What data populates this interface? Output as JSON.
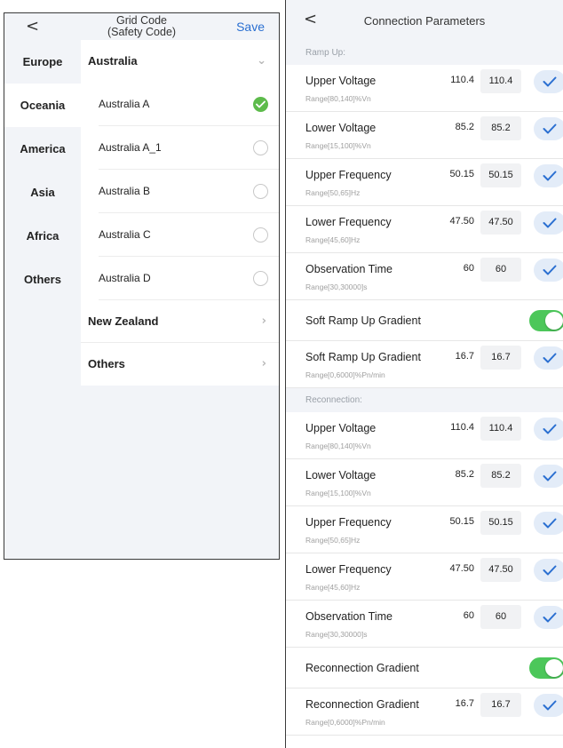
{
  "left": {
    "back_icon": "<",
    "title_line1": "Grid Code",
    "title_line2": "(Safety Code)",
    "save_label": "Save",
    "regions": [
      "Europe",
      "Oceania",
      "America",
      "Asia",
      "Africa",
      "Others"
    ],
    "active_region": "Oceania",
    "groups": [
      {
        "label": "Australia",
        "chevron": "chevron-down-icon"
      },
      {
        "label": "New Zealand",
        "chevron": "chevron-right-icon"
      },
      {
        "label": "Others",
        "chevron": "chevron-right-icon"
      }
    ],
    "countries": [
      {
        "label": "Australia A",
        "selected": true
      },
      {
        "label": "Australia A_1",
        "selected": false
      },
      {
        "label": "Australia B",
        "selected": false
      },
      {
        "label": "Australia C",
        "selected": false
      },
      {
        "label": "Australia D",
        "selected": false
      }
    ]
  },
  "right": {
    "back_icon": "<",
    "title": "Connection Parameters",
    "ramp_up": {
      "header": "Ramp Up:",
      "params": [
        {
          "name": "Upper Voltage",
          "range": "Range[80,140]%Vn",
          "current": "110.4",
          "input": "110.4"
        },
        {
          "name": "Lower Voltage",
          "range": "Range[15,100]%Vn",
          "current": "85.2",
          "input": "85.2"
        },
        {
          "name": "Upper Frequency",
          "range": "Range[50,65]Hz",
          "current": "50.15",
          "input": "50.15"
        },
        {
          "name": "Lower Frequency",
          "range": "Range[45,60]Hz",
          "current": "47.50",
          "input": "47.50"
        },
        {
          "name": "Observation Time",
          "range": "Range[30,30000]s",
          "current": "60",
          "input": "60"
        }
      ],
      "toggle_label": "Soft Ramp Up Gradient",
      "toggle_on": true,
      "gradient": {
        "name": "Soft Ramp Up Gradient",
        "range": "Range[0,6000]%Pn/min",
        "current": "16.7",
        "input": "16.7"
      }
    },
    "reconnection": {
      "header": "Reconnection:",
      "params": [
        {
          "name": "Upper Voltage",
          "range": "Range[80,140]%Vn",
          "current": "110.4",
          "input": "110.4"
        },
        {
          "name": "Lower Voltage",
          "range": "Range[15,100]%Vn",
          "current": "85.2",
          "input": "85.2"
        },
        {
          "name": "Upper Frequency",
          "range": "Range[50,65]Hz",
          "current": "50.15",
          "input": "50.15"
        },
        {
          "name": "Lower Frequency",
          "range": "Range[45,60]Hz",
          "current": "47.50",
          "input": "47.50"
        },
        {
          "name": "Observation Time",
          "range": "Range[30,30000]s",
          "current": "60",
          "input": "60"
        }
      ],
      "toggle_label": "Reconnection Gradient",
      "toggle_on": true,
      "gradient": {
        "name": "Reconnection Gradient",
        "range": "Range[0,6000]%Pn/min",
        "current": "16.7",
        "input": "16.7"
      }
    }
  },
  "colors": {
    "accent": "#2a6fd1",
    "selected_check": "#5dbb4b",
    "toggle_on": "#4cc75a",
    "confirm_bg": "#e3ecf8",
    "section_bg": "#f2f4f8"
  }
}
